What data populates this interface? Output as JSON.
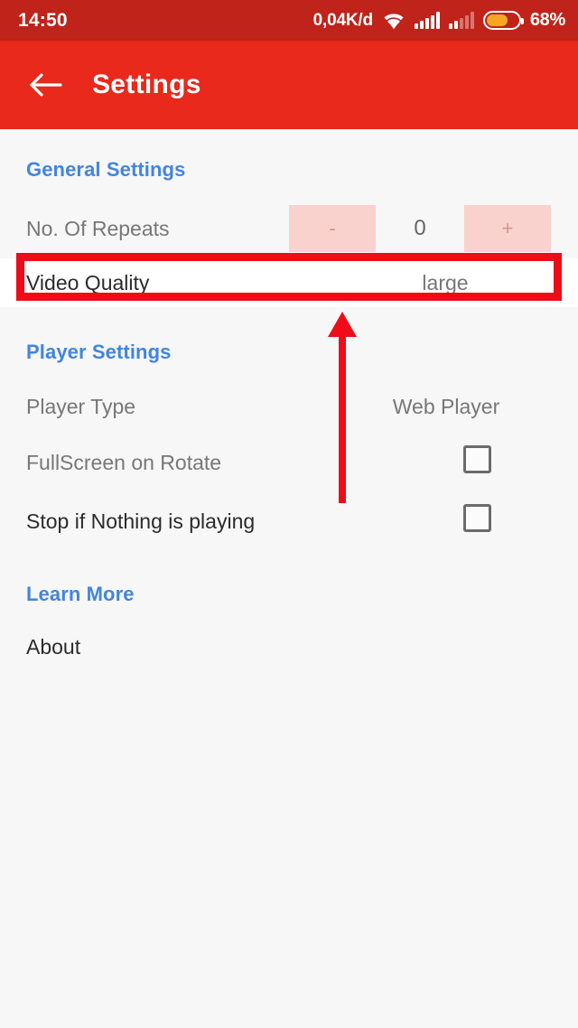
{
  "status_bar": {
    "clock": "14:50",
    "data_rate": "0,04K/d",
    "wifi_icon": "wifi-icon",
    "signal_primary_icon": "signal-bars-full-icon",
    "signal_secondary_icon": "signal-bars-partial-icon",
    "battery_icon": "battery-icon",
    "battery_percent": "68%",
    "battery_level": 68,
    "background_color": "#c0231a"
  },
  "app_bar": {
    "back_icon": "back-arrow-icon",
    "title": "Settings",
    "background_color": "#e8291b",
    "text_color": "#ffffff"
  },
  "sections": {
    "general": {
      "header": "General Settings",
      "repeats": {
        "label": "No. Of Repeats",
        "decrement_label": "-",
        "increment_label": "+",
        "value": "0"
      },
      "video_quality": {
        "label": "Video Quality",
        "value": "large"
      }
    },
    "player": {
      "header": "Player Settings",
      "player_type": {
        "label": "Player Type",
        "value": "Web Player"
      },
      "fullscreen_on_rotate": {
        "label": "FullScreen on Rotate",
        "checked": false
      },
      "stop_if_nothing_playing": {
        "label": "Stop if Nothing is playing",
        "checked": false
      }
    },
    "learn_more": {
      "header": "Learn More",
      "about": {
        "label": "About"
      }
    }
  },
  "annotations": {
    "highlight_box": {
      "name": "video-quality-highlight",
      "color": "#ef0c18"
    },
    "arrow": {
      "name": "pointer-arrow-up",
      "color": "#ef0c18"
    }
  },
  "theme": {
    "accent_blue": "#4285dd",
    "page_background": "#f7f7f7",
    "stepper_button_background": "#fad2cd",
    "annotation_red": "#ef0c18"
  }
}
